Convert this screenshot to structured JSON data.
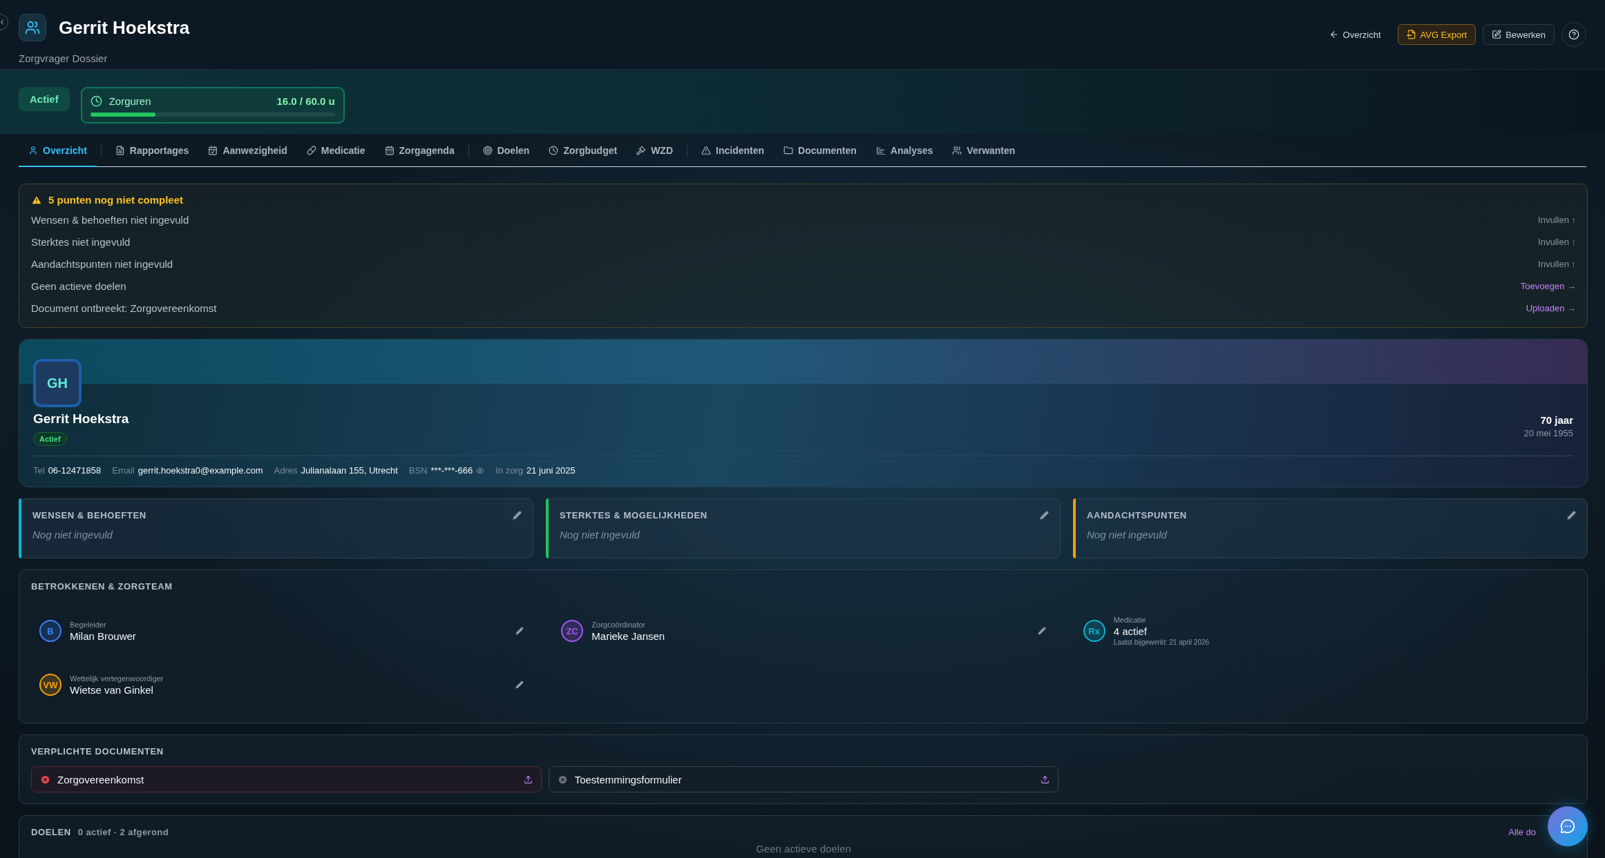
{
  "header": {
    "title": "Gerrit Hoekstra",
    "subtitle": "Zorgvrager Dossier",
    "back_link": "Overzicht",
    "buttons": [
      {
        "label": "AVG Export",
        "kind": "export"
      },
      {
        "label": "Bewerken",
        "kind": "edit"
      }
    ]
  },
  "status": {
    "badge": "Actief",
    "hours": {
      "label": "Zorguren",
      "reading": "16.0 / 60.0 u",
      "level": 0.267
    }
  },
  "tab_groups": [
    [
      {
        "label": "Overzicht",
        "selected": true
      }
    ],
    [
      {
        "label": "Rapportages",
        "selected": false
      },
      {
        "label": "Aanwezigheid",
        "selected": false
      },
      {
        "label": "Medicatie",
        "selected": false
      },
      {
        "label": "Zorgagenda",
        "selected": false
      }
    ],
    [
      {
        "label": "Doelen",
        "selected": false
      },
      {
        "label": "Zorgbudget",
        "selected": false
      },
      {
        "label": "WZD",
        "selected": false
      }
    ],
    [
      {
        "label": "Incidenten",
        "selected": false
      },
      {
        "label": "Documenten",
        "selected": false
      },
      {
        "label": "Analyses",
        "selected": false
      },
      {
        "label": "Verwanten",
        "selected": false
      }
    ]
  ],
  "checklist": {
    "title": "5 punten nog niet compleet",
    "items": [
      {
        "text": "Wensen & behoeften niet ingevuld",
        "action": "Invullen ↑",
        "kind": "fill"
      },
      {
        "text": "Sterktes niet ingevuld",
        "action": "Invullen ↑",
        "kind": "fill"
      },
      {
        "text": "Aandachtspunten niet ingevuld",
        "action": "Invullen ↑",
        "kind": "fill"
      },
      {
        "text": "Geen actieve doelen",
        "action": "Toevoegen →",
        "kind": "link"
      },
      {
        "text": "Document ontbreekt: Zorgovereenkomst",
        "action": "Uploaden →",
        "kind": "link"
      }
    ]
  },
  "profile": {
    "initials": "GH",
    "name": "Gerrit Hoekstra",
    "badge": "Actief",
    "age": "70 jaar",
    "birth_date": "20 mei 1955",
    "details": [
      {
        "label": "Tel",
        "value": "06-12471858",
        "kind": "plain"
      },
      {
        "label": "Email",
        "value": "gerrit.hoekstra0@example.com",
        "kind": "plain"
      },
      {
        "label": "Adres",
        "value": "Julianalaan 155, Utrecht",
        "kind": "plain"
      },
      {
        "label": "BSN",
        "value": "***-***-666",
        "kind": "masked"
      },
      {
        "label": "In zorg",
        "value": "21 juni 2025",
        "kind": "plain"
      }
    ]
  },
  "notes": [
    {
      "title": "WENSEN & BEHOEFTEN",
      "text": "Nog niet ingevuld",
      "color": "#06b6d4"
    },
    {
      "title": "STERKTES & MOGELIJKHEDEN",
      "text": "Nog niet ingevuld",
      "color": "#22c55e"
    },
    {
      "title": "AANDACHTSPUNTEN",
      "text": "Nog niet ingevuld",
      "color": "#f59e0b"
    }
  ],
  "team": {
    "title": "BETROKKENEN & ZORGTEAM",
    "members": [
      {
        "kind": "person",
        "initials": "B",
        "role": "Begeleider",
        "name": "Milan Brouwer",
        "color": "#3b82f6"
      },
      {
        "kind": "person",
        "initials": "ZC",
        "role": "Zorgcoördinator",
        "name": "Marieke Jansen",
        "color": "#a855f7"
      },
      {
        "kind": "summary",
        "initials": "Rx",
        "role": "Medicatie",
        "name": "4 actief",
        "note": "Laatst bijgewerkt: 21 april 2026",
        "color": "#06b6d4"
      },
      {
        "kind": "person",
        "initials": "VW",
        "role": "Wettelijk vertegenwoordiger",
        "name": "Wietse van Ginkel",
        "color": "#f59e0b"
      }
    ]
  },
  "documents": {
    "title": "VERPLICHTE DOCUMENTEN",
    "items": [
      {
        "name": "Zorgovereenkomst",
        "kind": "missing"
      },
      {
        "name": "Toestemmingsformulier",
        "kind": "optional"
      }
    ]
  },
  "goals": {
    "title": "DOELEN",
    "summary": "0 actief · 2 afgerond",
    "link": "Alle do",
    "empty": "Geen actieve doelen"
  }
}
